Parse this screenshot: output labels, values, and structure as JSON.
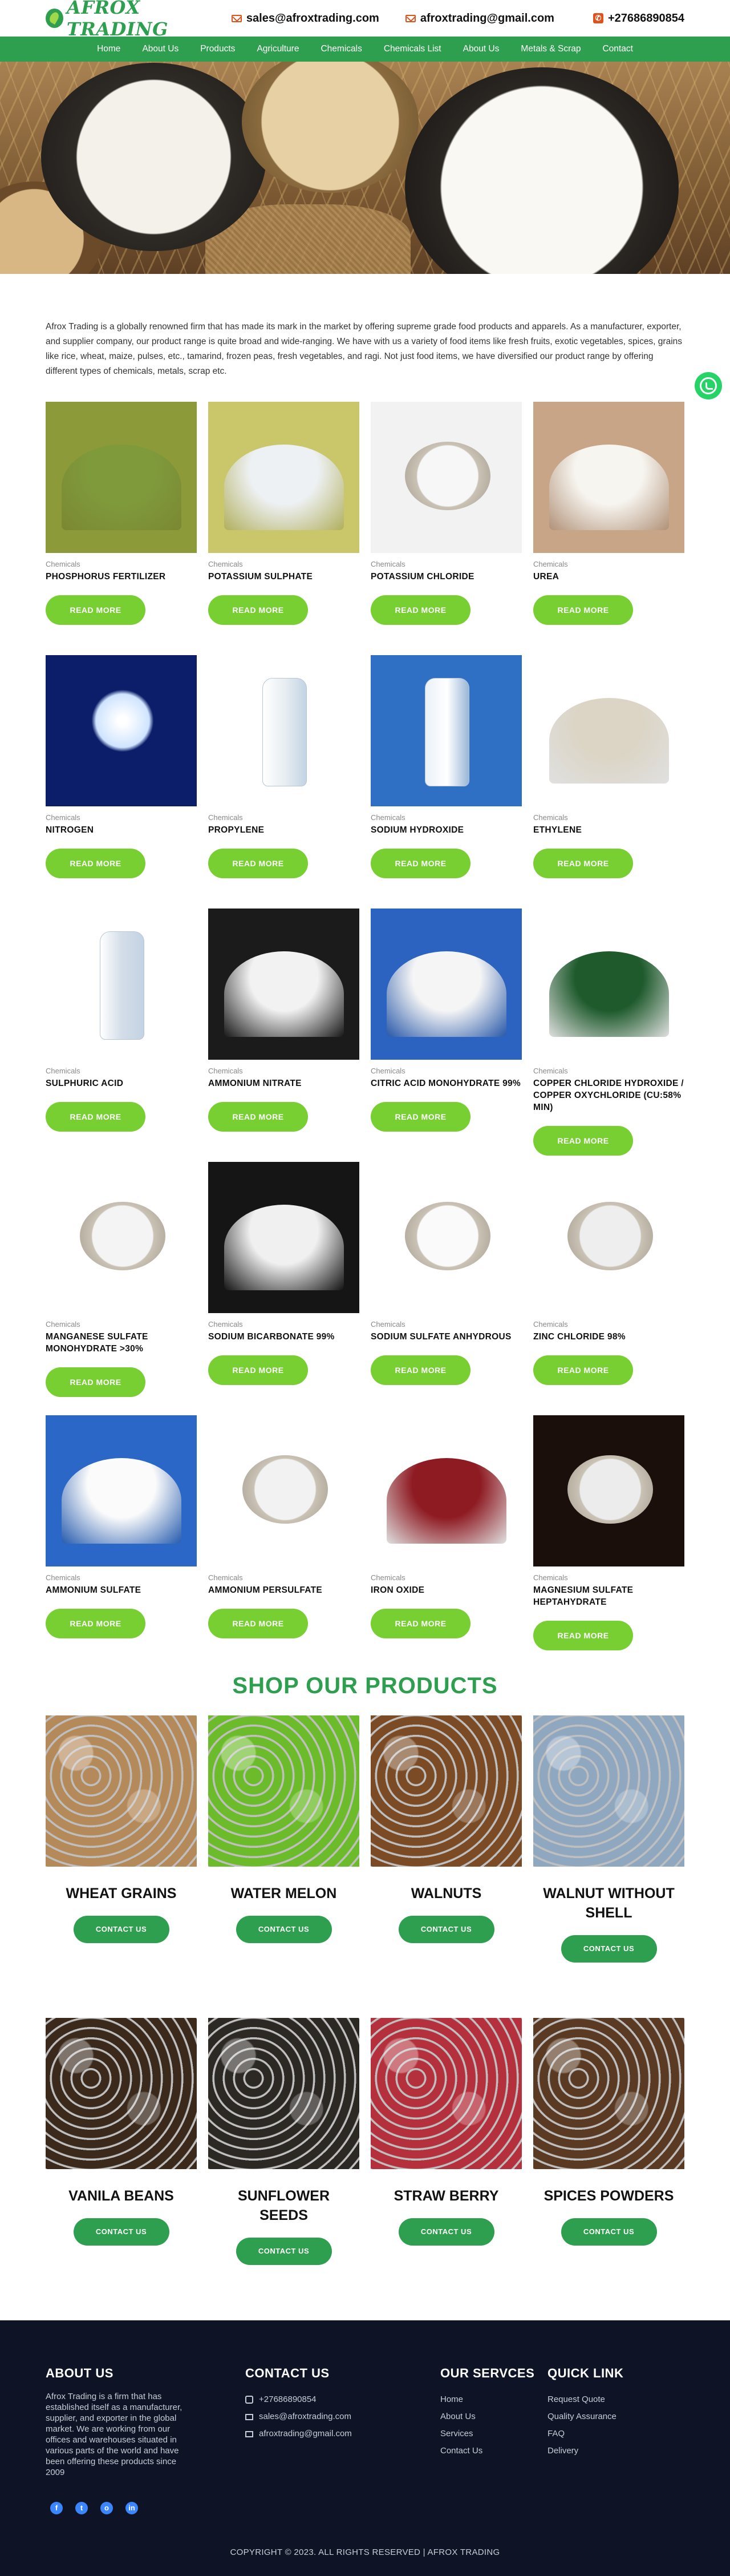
{
  "header": {
    "logo_text": "AFROX TRADING",
    "email_primary": "sales@afroxtrading.com",
    "email_secondary": "afroxtrading@gmail.com",
    "phone": "+27686890854"
  },
  "nav": {
    "items": [
      "Home",
      "About Us",
      "Products",
      "Agriculture",
      "Chemicals",
      "Chemicals List",
      "About Us",
      "Metals & Scrap",
      "Contact"
    ]
  },
  "intro": {
    "text": "Afrox Trading is a globally renowned firm that has made its mark in the market by offering supreme grade food products and apparels. As a manufacturer, exporter, and supplier company, our product range is quite broad and wide-ranging. We have with us a variety of food items like fresh fruits, exotic vegetables, spices, grains like rice, wheat, maize, pulses, etc., tamarind, frozen peas, fresh vegetables, and ragi. Not just food items, we have diversified our product range by offering different types of chemicals, metals, scrap etc."
  },
  "products": {
    "read_more_label": "READ MORE",
    "items": [
      {
        "category": "Chemicals",
        "name": "PHOSPHORUS FERTILIZER",
        "swatch": "#8c9a3a"
      },
      {
        "category": "Chemicals",
        "name": "POTASSIUM SULPHATE",
        "swatch": "#c9c76a"
      },
      {
        "category": "Chemicals",
        "name": "POTASSIUM CHLORIDE",
        "swatch": "#f2f2f2"
      },
      {
        "category": "Chemicals",
        "name": "UREA",
        "swatch": "#c9a588"
      },
      {
        "category": "Chemicals",
        "name": "NITROGEN",
        "swatch": "#0c1e6a"
      },
      {
        "category": "Chemicals",
        "name": "PROPYLENE",
        "swatch": "#ffffff"
      },
      {
        "category": "Chemicals",
        "name": "SODIUM HYDROXIDE",
        "swatch": "#2f6fc4"
      },
      {
        "category": "Chemicals",
        "name": "ETHYLENE",
        "swatch": "#ffffff"
      },
      {
        "category": "Chemicals",
        "name": "SULPHURIC ACID",
        "swatch": "#ffffff"
      },
      {
        "category": "Chemicals",
        "name": "AMMONIUM NITRATE",
        "swatch": "#1b1b1b"
      },
      {
        "category": "Chemicals",
        "name": "CITRIC ACID MONOHYDRATE 99%",
        "swatch": "#2c63c0"
      },
      {
        "category": "Chemicals",
        "name": "COPPER CHLORIDE HYDROXIDE / COPPER OXYCHLORIDE (CU:58% MIN)",
        "swatch": "#ffffff"
      },
      {
        "category": "Chemicals",
        "name": "MANGANESE SULFATE MONOHYDRATE >30%",
        "swatch": "#ffffff"
      },
      {
        "category": "Chemicals",
        "name": "SODIUM BICARBONATE 99%",
        "swatch": "#151515"
      },
      {
        "category": "Chemicals",
        "name": "SODIUM SULFATE ANHYDROUS",
        "swatch": "#ffffff"
      },
      {
        "category": "Chemicals",
        "name": "ZINC CHLORIDE 98%",
        "swatch": "#ffffff"
      },
      {
        "category": "Chemicals",
        "name": "AMMONIUM SULFATE",
        "swatch": "#2a67c6"
      },
      {
        "category": "Chemicals",
        "name": "AMMONIUM PERSULFATE",
        "swatch": "#ffffff"
      },
      {
        "category": "Chemicals",
        "name": "IRON OXIDE",
        "swatch": "#ffffff"
      },
      {
        "category": "Chemicals",
        "name": "MAGNESIUM SULFATE HEPTAHYDRATE",
        "swatch": "#1b0f0c"
      }
    ]
  },
  "shop": {
    "title": "SHOP OUR PRODUCTS",
    "contact_label": "CONTACT US",
    "items": [
      {
        "name": "WHEAT GRAINS"
      },
      {
        "name": "WATER MELON"
      },
      {
        "name": "WALNUTS"
      },
      {
        "name": "WALNUT WITHOUT SHELL"
      },
      {
        "name": "VANILA BEANS"
      },
      {
        "name": "SUNFLOWER SEEDS"
      },
      {
        "name": "STRAW BERRY"
      },
      {
        "name": "SPICES POWDERS"
      }
    ]
  },
  "footer": {
    "about": {
      "heading": "ABOUT US",
      "text": "Afrox Trading is a firm that has established itself as a manufacturer, supplier, and exporter in the global market. We are working from our offices and warehouses situated in various parts of the world and have been offering these products since 2009"
    },
    "contact": {
      "heading": "CONTACT US",
      "phone": "+27686890854",
      "email_primary": "sales@afroxtrading.com",
      "email_secondary": "afroxtrading@gmail.com"
    },
    "services": {
      "heading": "OUR SERVCES",
      "items": [
        "Home",
        "About Us",
        "Services",
        "Contact Us"
      ]
    },
    "quick_link": {
      "heading": "QUICK LINK",
      "items": [
        "Request Quote",
        "Quality Assurance",
        "FAQ",
        "Delivery"
      ]
    },
    "socials": [
      "f",
      "t",
      "o",
      "in"
    ],
    "copyright": "COPYRIGHT © 2023. ALL RIGHTS RESERVED | AFROX TRADING"
  }
}
